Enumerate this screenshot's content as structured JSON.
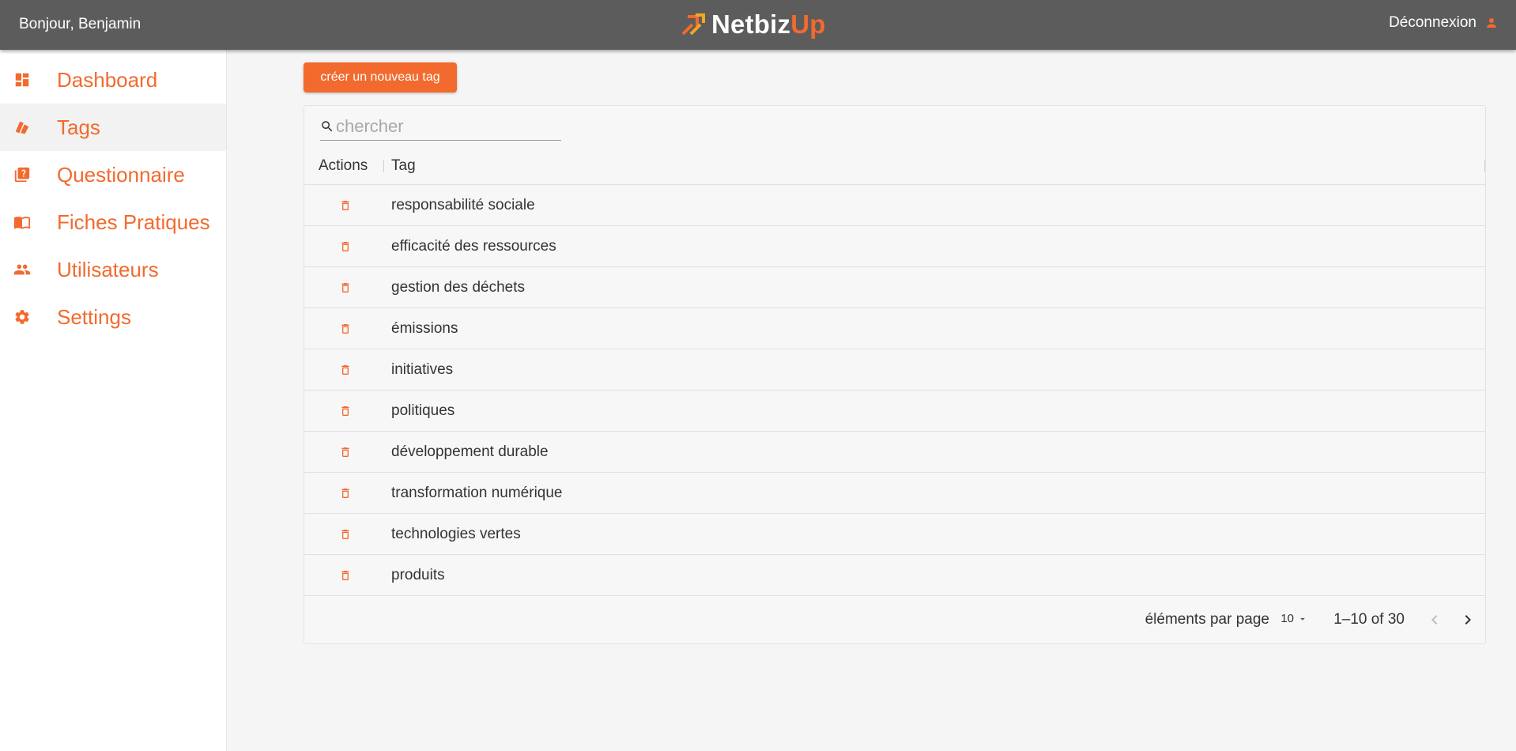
{
  "header": {
    "greeting": "Bonjour, Benjamin",
    "logo_part1": "Netbiz",
    "logo_part2": "Up",
    "logout_label": "Déconnexion"
  },
  "sidebar": {
    "items": [
      {
        "label": "Dashboard",
        "icon": "dashboard-icon"
      },
      {
        "label": "Tags",
        "icon": "tags-icon",
        "active": true
      },
      {
        "label": "Questionnaire",
        "icon": "questionnaire-icon"
      },
      {
        "label": "Fiches Pratiques",
        "icon": "book-icon"
      },
      {
        "label": "Utilisateurs",
        "icon": "users-icon"
      },
      {
        "label": "Settings",
        "icon": "gear-icon"
      }
    ]
  },
  "main": {
    "create_button": "créer un nouveau tag",
    "search": {
      "placeholder": "chercher",
      "value": ""
    },
    "columns": [
      "Actions",
      "Tag"
    ],
    "rows": [
      "responsabilité sociale",
      "efficacité des ressources",
      "gestion des déchets",
      "émissions",
      "initiatives",
      "politiques",
      "développement durable",
      "transformation numérique",
      "technologies vertes",
      "produits"
    ],
    "pagination": {
      "per_page_label": "éléments par page",
      "per_page_value": "10",
      "range": "1–10 of 30"
    }
  },
  "colors": {
    "accent": "#f26a2e",
    "header_bg": "#5c5c5c"
  }
}
